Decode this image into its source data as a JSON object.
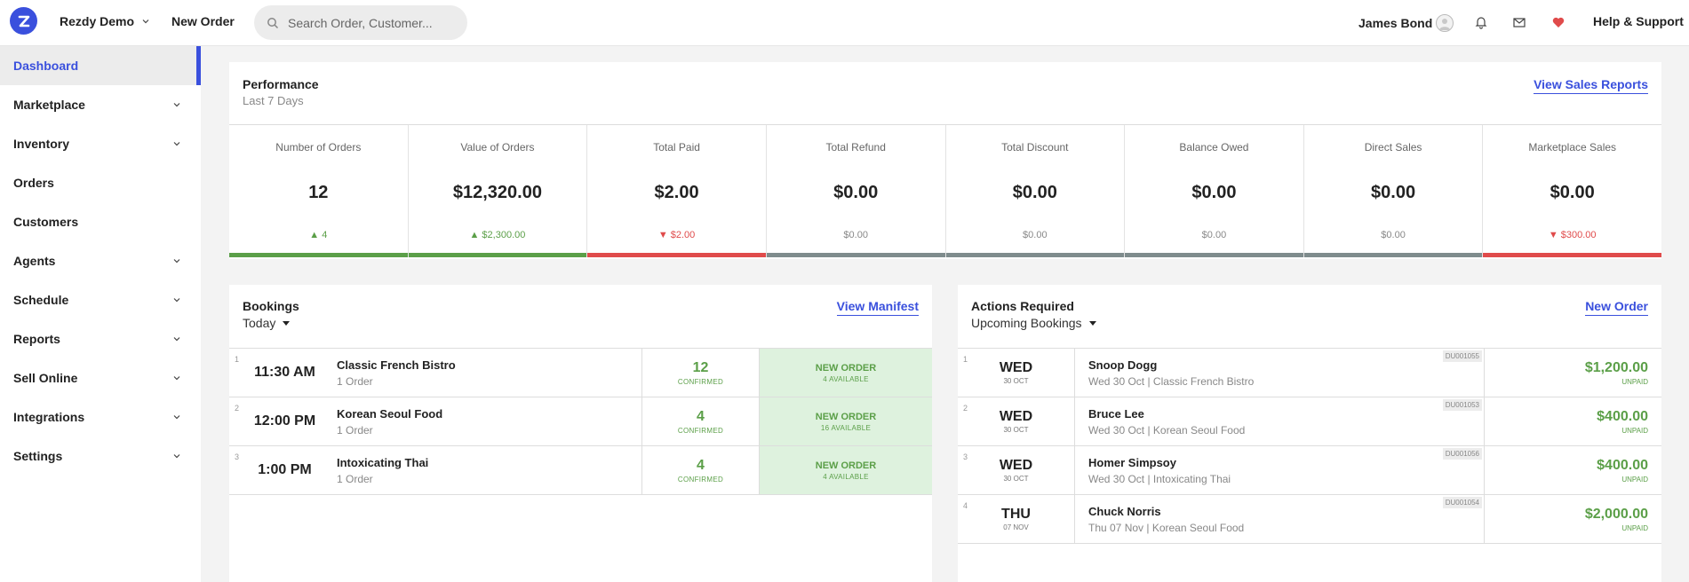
{
  "topbar": {
    "account": "Rezdy Demo",
    "new_order": "New Order",
    "search_placeholder": "Search Order, Customer...",
    "user": "James Bond",
    "help": "Help & Support"
  },
  "sidebar": {
    "items": [
      {
        "label": "Dashboard",
        "chevron": false
      },
      {
        "label": "Marketplace",
        "chevron": true
      },
      {
        "label": "Inventory",
        "chevron": true
      },
      {
        "label": "Orders",
        "chevron": false
      },
      {
        "label": "Customers",
        "chevron": false
      },
      {
        "label": "Agents",
        "chevron": true
      },
      {
        "label": "Schedule",
        "chevron": true
      },
      {
        "label": "Reports",
        "chevron": true
      },
      {
        "label": "Sell Online",
        "chevron": true
      },
      {
        "label": "Integrations",
        "chevron": true
      },
      {
        "label": "Settings",
        "chevron": true
      }
    ]
  },
  "performance": {
    "title": "Performance",
    "subtitle": "Last 7 Days",
    "link": "View Sales Reports",
    "metrics": [
      {
        "label": "Number of Orders",
        "value": "12",
        "delta": "▲ 4",
        "trend": "up"
      },
      {
        "label": "Value of Orders",
        "value": "$12,320.00",
        "delta": "▲ $2,300.00",
        "trend": "up"
      },
      {
        "label": "Total Paid",
        "value": "$2.00",
        "delta": "▼ $2.00",
        "trend": "down"
      },
      {
        "label": "Total Refund",
        "value": "$0.00",
        "delta": "$0.00",
        "trend": "flat"
      },
      {
        "label": "Total Discount",
        "value": "$0.00",
        "delta": "$0.00",
        "trend": "flat"
      },
      {
        "label": "Balance Owed",
        "value": "$0.00",
        "delta": "$0.00",
        "trend": "flat"
      },
      {
        "label": "Direct Sales",
        "value": "$0.00",
        "delta": "$0.00",
        "trend": "flat"
      },
      {
        "label": "Marketplace Sales",
        "value": "$0.00",
        "delta": "▼ $300.00",
        "trend": "down"
      }
    ]
  },
  "bookings": {
    "title": "Bookings",
    "filter": "Today",
    "link": "View Manifest",
    "rows": [
      {
        "index": "1",
        "time": "11:30 AM",
        "name": "Classic French Bistro",
        "orders": "1 Order",
        "count": "12",
        "count_label": "CONFIRMED",
        "action": "NEW ORDER",
        "available": "4 AVAILABLE"
      },
      {
        "index": "2",
        "time": "12:00 PM",
        "name": "Korean Seoul Food",
        "orders": "1 Order",
        "count": "4",
        "count_label": "CONFIRMED",
        "action": "NEW ORDER",
        "available": "16 AVAILABLE"
      },
      {
        "index": "3",
        "time": "1:00 PM",
        "name": "Intoxicating Thai",
        "orders": "1 Order",
        "count": "4",
        "count_label": "CONFIRMED",
        "action": "NEW ORDER",
        "available": "4 AVAILABLE"
      }
    ]
  },
  "actions": {
    "title": "Actions Required",
    "filter": "Upcoming Bookings",
    "link": "New Order",
    "rows": [
      {
        "index": "1",
        "dow": "WED",
        "date": "30 OCT",
        "name": "Snoop Dogg",
        "detail": "Wed 30 Oct | Classic French Bistro",
        "code": "DU001055",
        "amount": "$1,200.00",
        "status": "UNPAID"
      },
      {
        "index": "2",
        "dow": "WED",
        "date": "30 OCT",
        "name": "Bruce Lee",
        "detail": "Wed 30 Oct | Korean Seoul Food",
        "code": "DU001053",
        "amount": "$400.00",
        "status": "UNPAID"
      },
      {
        "index": "3",
        "dow": "WED",
        "date": "30 OCT",
        "name": "Homer Simpsoy",
        "detail": "Wed 30 Oct | Intoxicating Thai",
        "code": "DU001056",
        "amount": "$400.00",
        "status": "UNPAID"
      },
      {
        "index": "4",
        "dow": "THU",
        "date": "07 NOV",
        "name": "Chuck Norris",
        "detail": "Thu 07 Nov | Korean Seoul Food",
        "code": "DU001054",
        "amount": "$2,000.00",
        "status": "UNPAID"
      }
    ]
  },
  "colors": {
    "accent": "#3a50dd",
    "positive": "#5b9f48",
    "negative": "#e04b4b",
    "neutral": "#7f8c8d",
    "available_bg": "#def2de"
  },
  "icons": [
    "rezdy-logo-icon",
    "chevron-down-icon",
    "search-icon",
    "avatar-icon",
    "bell-icon",
    "mail-icon",
    "heart-icon"
  ]
}
